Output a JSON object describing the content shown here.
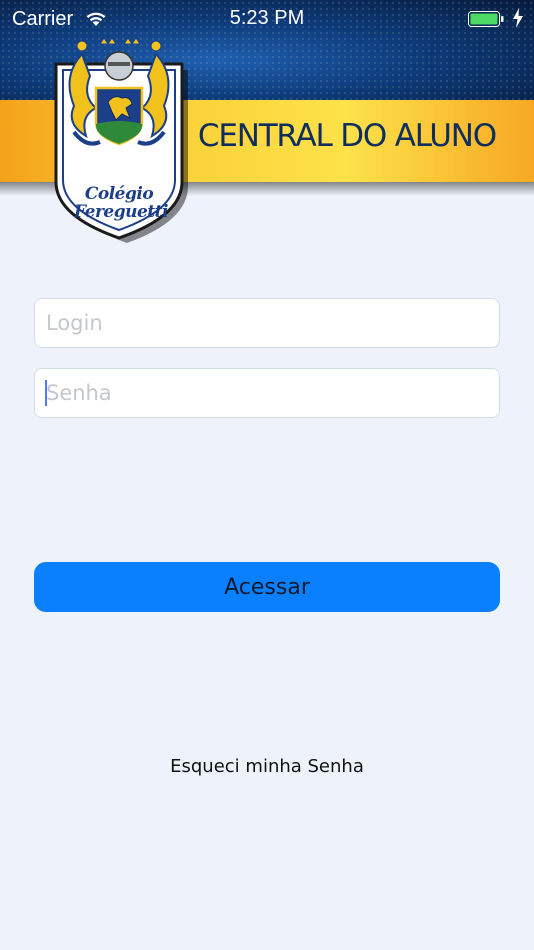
{
  "status_bar": {
    "carrier": "Carrier",
    "time": "5:23 PM",
    "battery_color": "#4cd964"
  },
  "header": {
    "title": "CENTRAL DO ALUNO",
    "crest": {
      "line1": "Colégio",
      "line2": "Fereguetti"
    },
    "colors": {
      "top": "#0d3b7a",
      "band": "#fbd23a",
      "title": "#0f2e5e"
    }
  },
  "form": {
    "login_placeholder": "Login",
    "login_value": "",
    "senha_placeholder": "Senha",
    "senha_value": "",
    "submit_label": "Acessar",
    "submit_color": "#0a80ff"
  },
  "links": {
    "forgot_password": "Esqueci minha Senha"
  },
  "icons": [
    "wifi-icon",
    "battery-icon",
    "charging-bolt-icon",
    "school-crest-logo"
  ]
}
